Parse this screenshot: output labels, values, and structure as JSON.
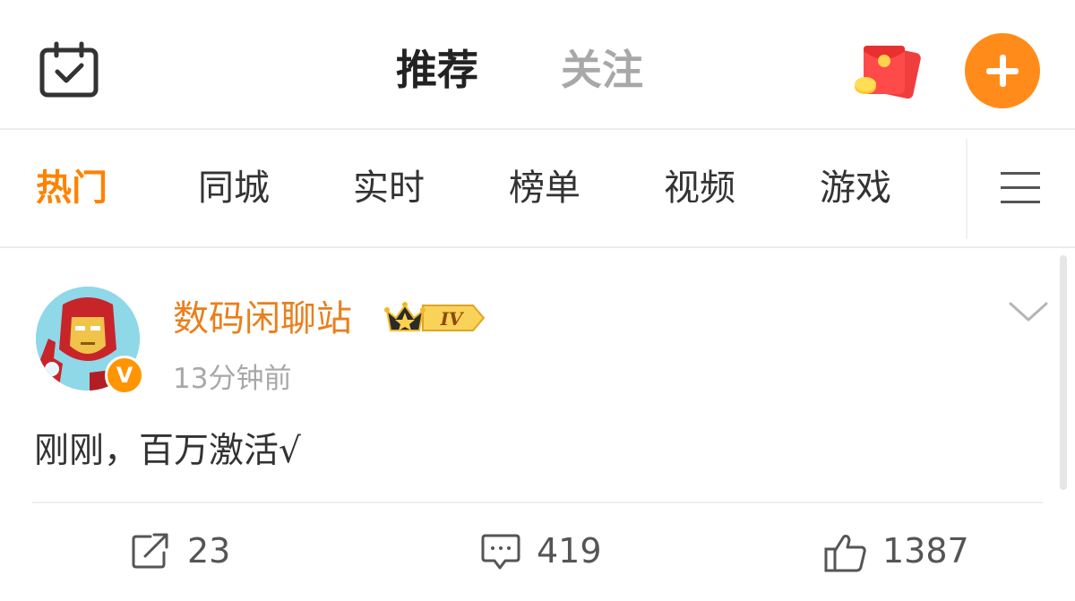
{
  "header": {
    "tabs": [
      {
        "label": "推荐",
        "active": true
      },
      {
        "label": "关注",
        "active": false
      }
    ],
    "icons": {
      "left": "calendar-check-icon",
      "red_packet": "red-packet-icon",
      "compose": "plus-icon"
    },
    "accent_color": "#ff8c1a"
  },
  "channels": {
    "items": [
      {
        "label": "热门",
        "active": true
      },
      {
        "label": "同城",
        "active": false
      },
      {
        "label": "实时",
        "active": false
      },
      {
        "label": "榜单",
        "active": false
      },
      {
        "label": "视频",
        "active": false
      },
      {
        "label": "游戏",
        "active": false
      }
    ],
    "more_icon": "hamburger-menu-icon",
    "active_color": "#ff8200"
  },
  "post": {
    "username": "数码闲聊站",
    "username_color": "#ea7f1c",
    "level_badge": "IV",
    "time": "13分钟前",
    "text": "刚刚，百万激活√",
    "verified_badge": "V",
    "actions": {
      "repost": {
        "icon": "repost-icon",
        "count": "23"
      },
      "comment": {
        "icon": "comment-icon",
        "count": "419"
      },
      "like": {
        "icon": "thumbs-up-icon",
        "count": "1387"
      }
    }
  }
}
